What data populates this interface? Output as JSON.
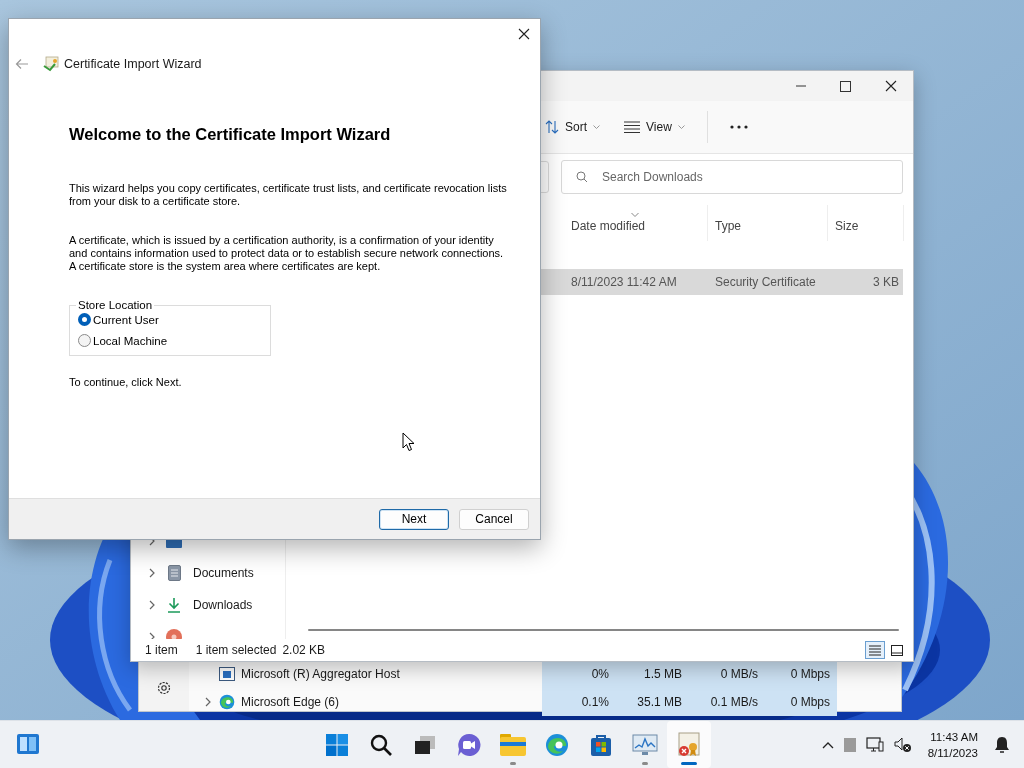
{
  "wizard": {
    "title": "Certificate Import Wizard",
    "heading": "Welcome to the Certificate Import Wizard",
    "paragraphs": [
      "This wizard helps you copy certificates, certificate trust lists, and certificate revocation lists from your disk to a certificate store.",
      "A certificate, which is issued by a certification authority, is a confirmation of your identity and contains information used to protect data or to establish secure network connections. A certificate store is the system area where certificates are kept."
    ],
    "store_location": {
      "label": "Store Location",
      "options": [
        {
          "label": "Current User",
          "selected": true
        },
        {
          "label": "Local Machine",
          "selected": false
        }
      ]
    },
    "note": "To continue, click Next.",
    "buttons": [
      {
        "label": "Next",
        "default": true
      },
      {
        "label": "Cancel",
        "default": false
      }
    ]
  },
  "file_explorer": {
    "toolbar": [
      {
        "kind": "sort",
        "label": "Sort"
      },
      {
        "kind": "view",
        "label": "View"
      }
    ],
    "search": {
      "placeholder": "Search Downloads"
    },
    "columns": [
      "Date modified",
      "Type",
      "Size"
    ],
    "rows": [
      {
        "date_modified": "8/11/2023 11:42 AM",
        "type": "Security Certificate",
        "size": "3 KB",
        "selected": true
      }
    ],
    "sidebar": [
      {
        "kind": "desktop"
      },
      {
        "kind": "documents",
        "label": "Documents"
      },
      {
        "kind": "downloads",
        "label": "Downloads"
      },
      {
        "kind": "music"
      }
    ],
    "status_bar": {
      "count": "1 item",
      "selection": "1 item selected",
      "size": "2.02 KB"
    },
    "views": [
      {
        "kind": "details",
        "selected": true
      },
      {
        "kind": "tiles",
        "selected": false
      }
    ]
  },
  "task_manager": {
    "rows": [
      {
        "kind": "app-host",
        "name": "Microsoft (R) Aggregator Host",
        "expandable": false,
        "cpu": "0%",
        "memory": "1.5 MB",
        "disk": "0 MB/s",
        "network": "0 Mbps"
      },
      {
        "kind": "edge",
        "name": "Microsoft Edge (6)",
        "expandable": true,
        "cpu": "0.1%",
        "memory": "35.1 MB",
        "disk": "0.1 MB/s",
        "network": "0 Mbps"
      }
    ]
  },
  "taskbar": {
    "apps": [
      {
        "kind": "start",
        "running": false,
        "active": false
      },
      {
        "kind": "search",
        "running": false,
        "active": false
      },
      {
        "kind": "taskview",
        "running": false,
        "active": false
      },
      {
        "kind": "chat",
        "running": false,
        "active": false
      },
      {
        "kind": "explorer",
        "running": true,
        "active": false
      },
      {
        "kind": "edge",
        "running": false,
        "active": false
      },
      {
        "kind": "store",
        "running": false,
        "active": false
      },
      {
        "kind": "perfmon",
        "running": true,
        "active": false
      },
      {
        "kind": "certificate",
        "running": true,
        "active": true
      }
    ],
    "time": "11:43 AM",
    "date": "8/11/2023"
  }
}
